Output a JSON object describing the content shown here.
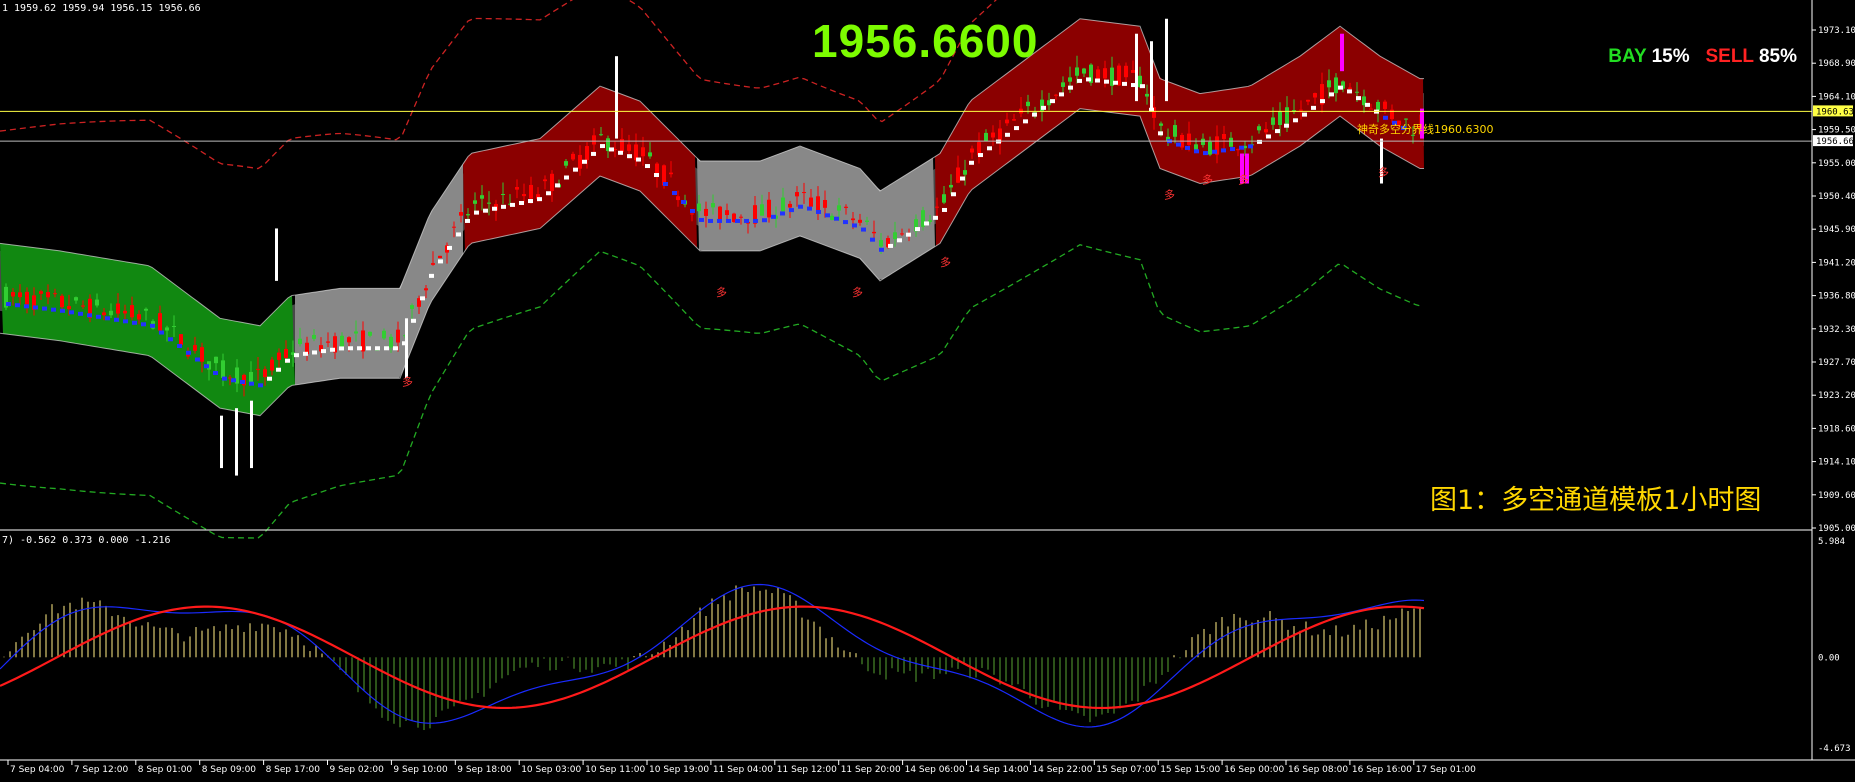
{
  "header": {
    "ohlc": "1 1959.62 1959.94 1956.15 1956.66",
    "big_price": "1956.6600",
    "bay_label": "BAY",
    "bay_pct": "15%",
    "sell_label": "SELL",
    "sell_pct": "85%",
    "caption": "图1：多空通道模板1小时图"
  },
  "main_chart": {
    "price_axis": [
      "1973.10",
      "1968.90",
      "1964.10",
      "1959.50",
      "1955.00",
      "1950.40",
      "1945.90",
      "1941.20",
      "1936.80",
      "1932.30",
      "1927.70",
      "1923.20",
      "1918.60",
      "1914.10",
      "1909.60",
      "1905.00"
    ],
    "y_range": [
      1905.0,
      1973.1
    ],
    "yellow_line_price": 1960.63,
    "yellow_line_tag": "1960.63",
    "white_line_price": 1956.66,
    "white_line_tag": "1956.66",
    "bull_bear_line_label": "神奇多空分界线1960.6300",
    "signal_char": "多",
    "colors": {
      "bull_candle": "#32cd32",
      "bear_candle": "#ff0000",
      "tick_bar": "#ffffff",
      "magenta_bar": "#ff00ff",
      "green_channel": "#118811",
      "grey_channel": "#888888",
      "red_channel": "#8b0000",
      "dark_band": "#555555",
      "outer_red_dash": "#cc2222",
      "outer_green_dash": "#22aa22",
      "yellow_line": "#ffff44"
    }
  },
  "macd_panel": {
    "params": "7) -0.562 0.373 0.000 -1.216",
    "axis": [
      "5.984",
      "0.00",
      "-4.673"
    ],
    "range": [
      -4.673,
      5.984
    ]
  },
  "time_axis": [
    "7 Sep 04:00",
    "7 Sep 12:00",
    "8 Sep 01:00",
    "8 Sep 09:00",
    "8 Sep 17:00",
    "9 Sep 02:00",
    "9 Sep 10:00",
    "9 Sep 18:00",
    "10 Sep 03:00",
    "10 Sep 11:00",
    "10 Sep 19:00",
    "11 Sep 04:00",
    "11 Sep 12:00",
    "11 Sep 20:00",
    "14 Sep 06:00",
    "14 Sep 14:00",
    "14 Sep 22:00",
    "15 Sep 07:00",
    "15 Sep 15:00",
    "16 Sep 00:00",
    "16 Sep 08:00",
    "16 Sep 16:00",
    "17 Sep 01:00"
  ]
}
